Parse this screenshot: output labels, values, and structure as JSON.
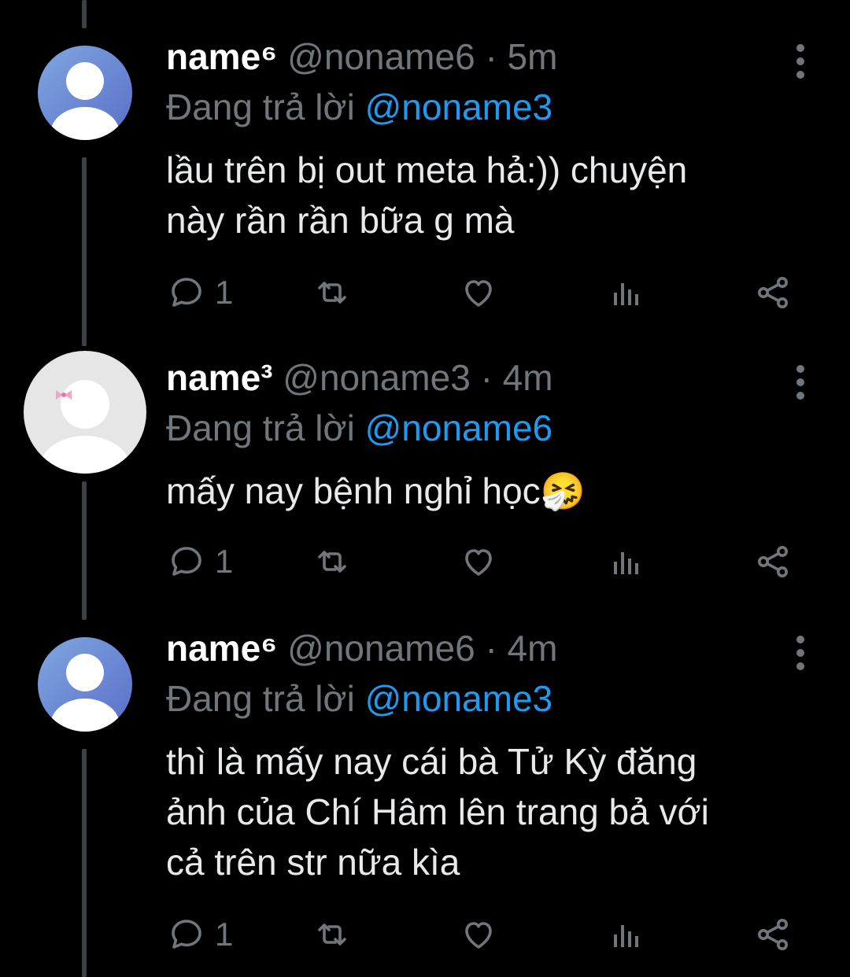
{
  "tweets": [
    {
      "display_name": "name⁶",
      "handle": "@noname6",
      "separator": "·",
      "time": "5m",
      "replying_prefix": "Đang trả lời",
      "replying_to": "@noname3",
      "text_lines": [
        "lầu trên bị out meta hả:)) chuyện",
        "này rần rần bữa g mà"
      ],
      "reply_count": "1",
      "avatar": "default-avatar-blue"
    },
    {
      "display_name": "name³",
      "handle": "@noname3",
      "separator": "·",
      "time": "4m",
      "replying_prefix": "Đang trả lời",
      "replying_to": "@noname6",
      "text_lines": [
        "mấy nay bệnh nghỉ học🤧"
      ],
      "reply_count": "1",
      "avatar": "default-avatar-white-with-pink-bow"
    },
    {
      "display_name": "name⁶",
      "handle": "@noname6",
      "separator": "·",
      "time": "4m",
      "replying_prefix": "Đang trả lời",
      "replying_to": "@noname3",
      "text_lines": [
        "thì là mấy nay cái bà Tử Kỳ đăng",
        "ảnh của Chí Hâm lên trang bả với",
        "cả trên str nữa kìa"
      ],
      "reply_count": "1",
      "avatar": "default-avatar-blue"
    }
  ],
  "icons": [
    "reply-icon",
    "retweet-icon",
    "like-icon",
    "analytics-icon",
    "share-icon",
    "more-options-icon"
  ],
  "colors": {
    "background": "#000000",
    "primary_text": "#e7e9ea",
    "secondary_text": "#71767b",
    "mention": "#1d9bf0",
    "thread_line": "#3d4145"
  }
}
